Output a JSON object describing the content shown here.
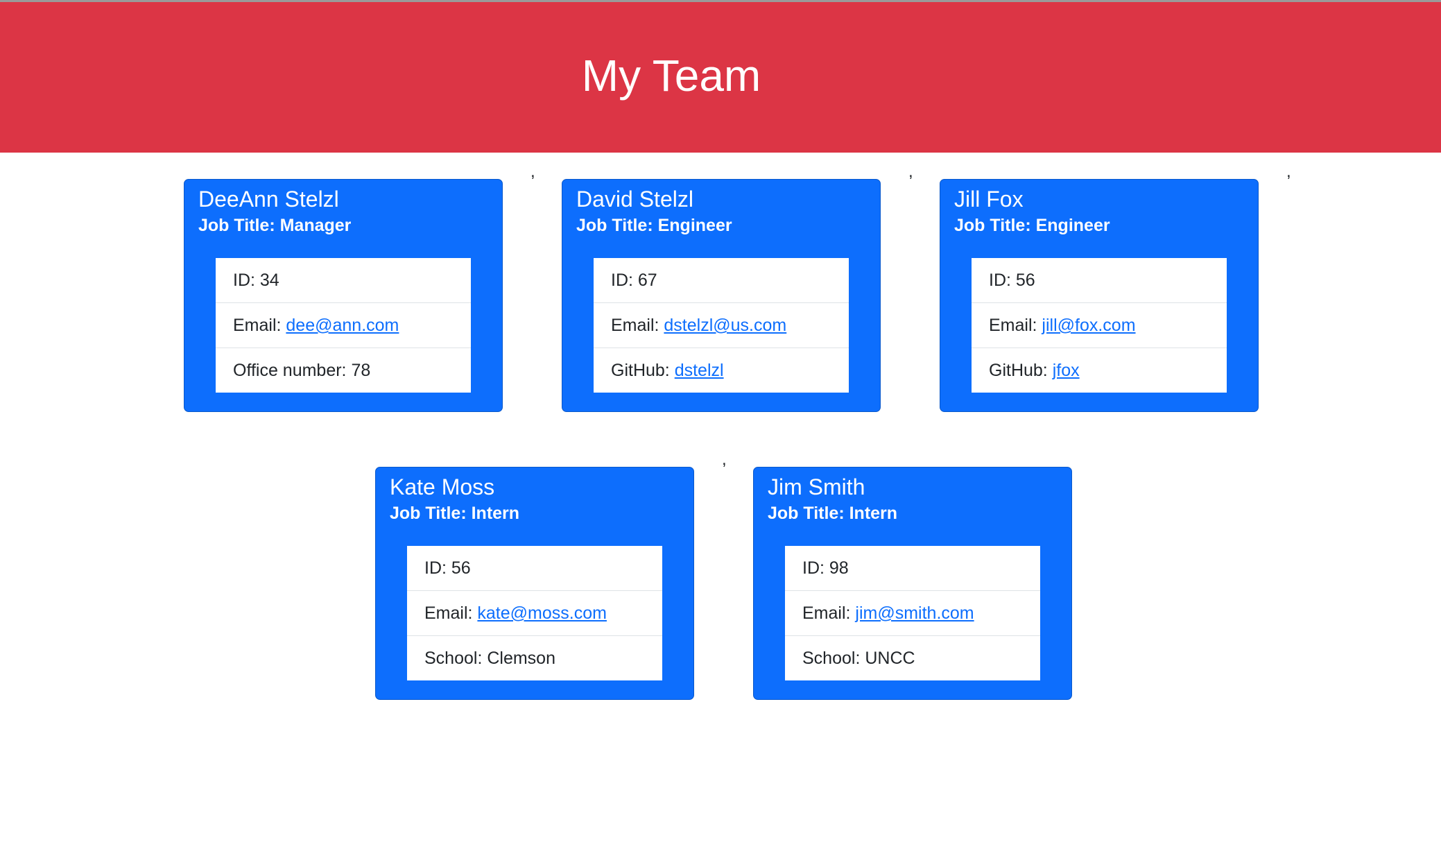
{
  "header": {
    "title": "My Team"
  },
  "separator": ",",
  "cards": [
    {
      "name": "DeeAnn Stelzl",
      "role": "Job Title: Manager",
      "id": "ID: 34",
      "email_label": "Email: ",
      "email": "dee@ann.com",
      "extra_label": "Office number: 78",
      "extra_link": ""
    },
    {
      "name": "David Stelzl",
      "role": "Job Title: Engineer",
      "id": "ID: 67",
      "email_label": "Email: ",
      "email": "dstelzl@us.com",
      "extra_label": "GitHub: ",
      "extra_link": "dstelzl"
    },
    {
      "name": "Jill Fox",
      "role": "Job Title: Engineer",
      "id": "ID: 56",
      "email_label": "Email: ",
      "email": "jill@fox.com",
      "extra_label": "GitHub: ",
      "extra_link": "jfox"
    },
    {
      "name": "Kate Moss",
      "role": "Job Title: Intern",
      "id": "ID: 56",
      "email_label": "Email: ",
      "email": "kate@moss.com",
      "extra_label": "School: Clemson",
      "extra_link": ""
    },
    {
      "name": "Jim Smith",
      "role": "Job Title: Intern",
      "id": "ID: 98",
      "email_label": "Email: ",
      "email": "jim@smith.com",
      "extra_label": "School: UNCC",
      "extra_link": ""
    }
  ]
}
